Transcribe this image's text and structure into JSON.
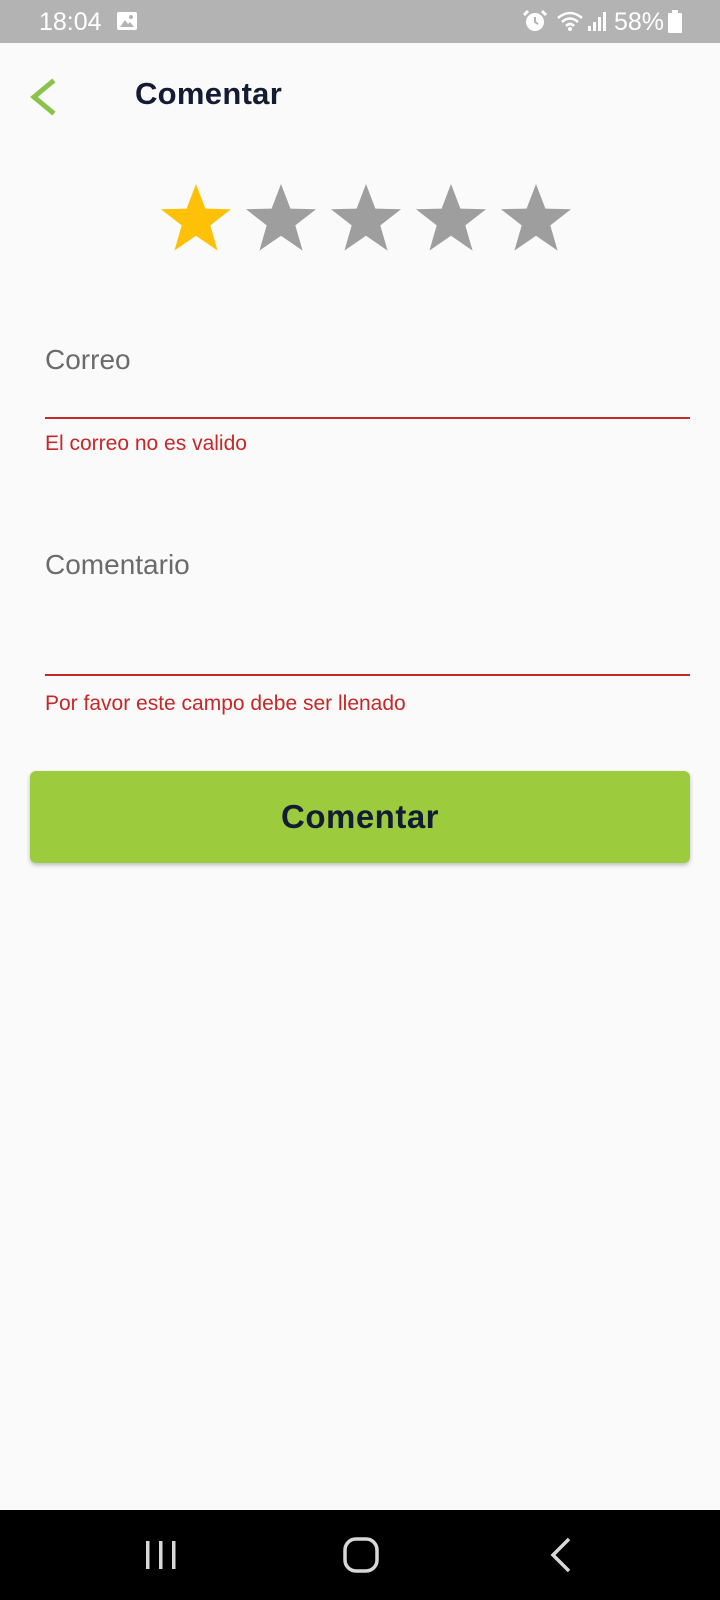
{
  "status_bar": {
    "time": "18:04",
    "battery": "58%",
    "icons": [
      "gallery-icon",
      "alarm-icon",
      "wifi-icon",
      "signal-icon",
      "battery-icon"
    ]
  },
  "header": {
    "title": "Comentar",
    "back_icon": "chevron-left-icon"
  },
  "rating": {
    "value": 1,
    "max": 5,
    "active_color": "#ffc107",
    "inactive_color": "#9e9e9e"
  },
  "form": {
    "email": {
      "label": "Correo",
      "value": "",
      "error": "El correo no es valido"
    },
    "comment": {
      "label": "Comentario",
      "value": "",
      "error": "Por favor este campo debe ser llenado"
    },
    "submit_label": "Comentar"
  },
  "colors": {
    "accent": "#9ccc3e",
    "title": "#141c33",
    "error": "#c62828",
    "background": "#fafafa",
    "status_bar": "#b3b3b3"
  },
  "nav_bar": {
    "icons": [
      "recents-icon",
      "home-icon",
      "back-icon"
    ]
  }
}
